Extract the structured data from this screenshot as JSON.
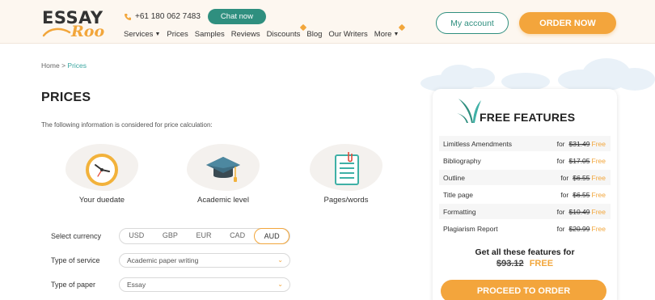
{
  "header": {
    "logo": {
      "line1": "ESSAY",
      "line2": "Roo"
    },
    "phone": "+61 180 062 7483",
    "chat_label": "Chat now",
    "nav": [
      {
        "label": "Services",
        "dropdown": true
      },
      {
        "label": "Prices"
      },
      {
        "label": "Samples"
      },
      {
        "label": "Reviews"
      },
      {
        "label": "Discounts",
        "flag": true
      },
      {
        "label": "Blog"
      },
      {
        "label": "Our Writers"
      },
      {
        "label": "More",
        "dropdown": true,
        "flag": true
      }
    ],
    "account_label": "My account",
    "order_label": "ORDER NOW"
  },
  "breadcrumb": {
    "home": "Home",
    "separator": ">",
    "current": "Prices"
  },
  "page_title": "PRICES",
  "intro": "The following information is considered for price calculation:",
  "features": [
    {
      "icon": "clock-icon",
      "label": "Your duedate"
    },
    {
      "icon": "graduation-cap-icon",
      "label": "Academic level"
    },
    {
      "icon": "document-icon",
      "label": "Pages/words"
    }
  ],
  "form": {
    "currency_label": "Select currency",
    "currencies": [
      "USD",
      "GBP",
      "EUR",
      "CAD",
      "AUD"
    ],
    "selected_currency": "AUD",
    "service_label": "Type of service",
    "service_value": "Academic paper writing",
    "paper_label": "Type of paper",
    "paper_value": "Essay"
  },
  "free_features": {
    "title": "FREE FEATURES",
    "items": [
      {
        "name": "Limitless Amendments",
        "for": "for",
        "old_price": "$31.49",
        "free": "Free"
      },
      {
        "name": "Bibliography",
        "for": "for",
        "old_price": "$17.05",
        "free": "Free"
      },
      {
        "name": "Outline",
        "for": "for",
        "old_price": "$6.55",
        "free": "Free"
      },
      {
        "name": "Title page",
        "for": "for",
        "old_price": "$6.55",
        "free": "Free"
      },
      {
        "name": "Formatting",
        "for": "for",
        "old_price": "$10.49",
        "free": "Free"
      },
      {
        "name": "Plagiarism Report",
        "for": "for",
        "old_price": "$20.99",
        "free": "Free"
      }
    ],
    "cta_text": "Get all these features for",
    "cta_old_price": "$93.12",
    "cta_free": "FREE",
    "proceed_label": "PROCEED TO ORDER"
  },
  "colors": {
    "accent_orange": "#f3a53c",
    "accent_teal": "#2f8f7f",
    "link_teal": "#3aa6a0"
  }
}
